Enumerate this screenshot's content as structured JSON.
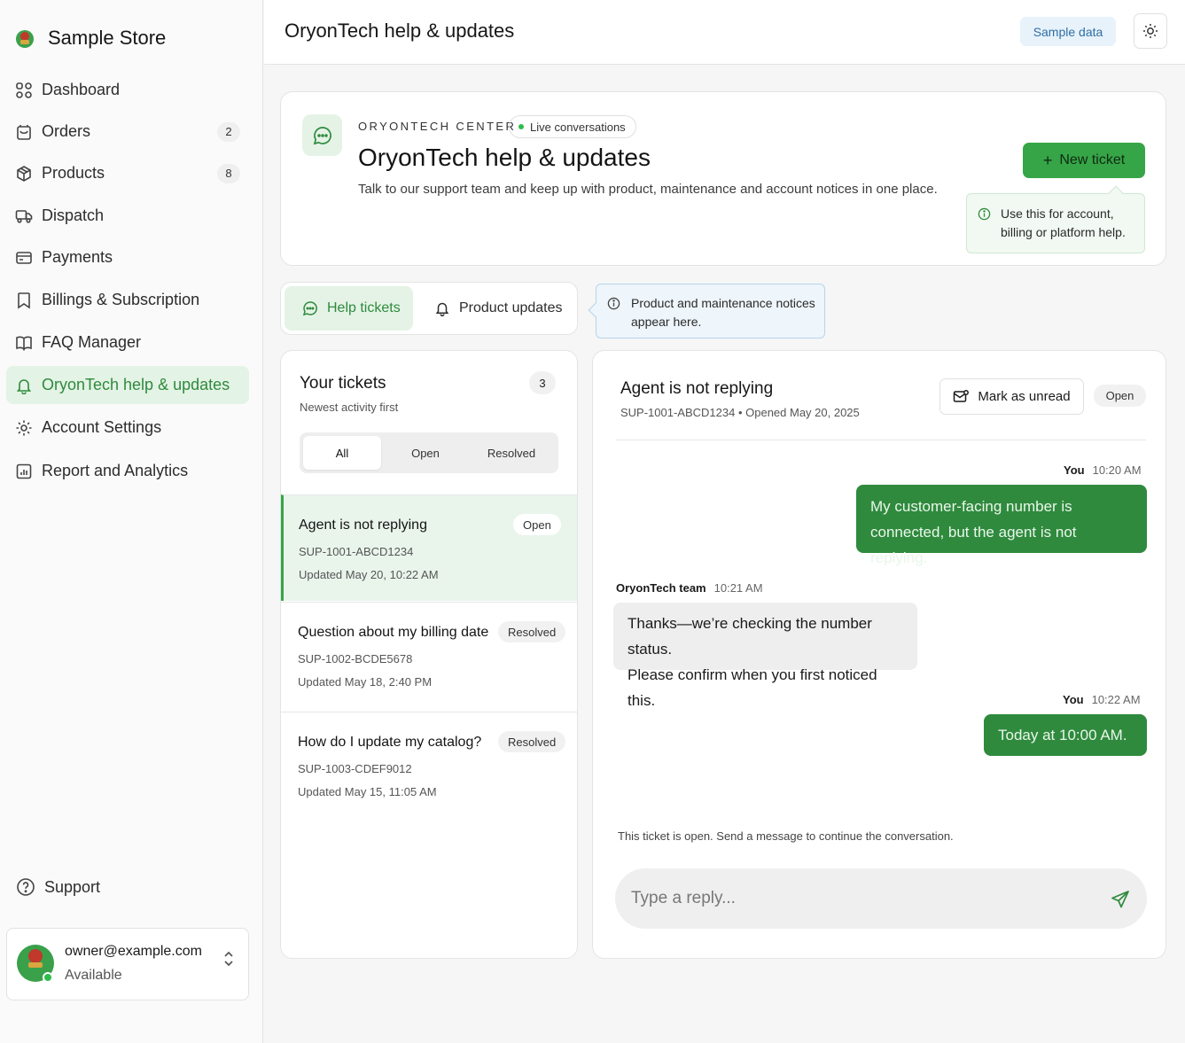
{
  "brand": {
    "name": "Sample Store"
  },
  "sidebar": {
    "items": [
      {
        "label": "Dashboard",
        "icon": "dashboard-icon"
      },
      {
        "label": "Orders",
        "icon": "orders-icon",
        "badge": "2"
      },
      {
        "label": "Products",
        "icon": "products-icon",
        "badge": "8"
      },
      {
        "label": "Dispatch",
        "icon": "truck-icon"
      },
      {
        "label": "Payments",
        "icon": "payments-icon"
      },
      {
        "label": "Billings & Subscription",
        "icon": "bookmark-icon"
      },
      {
        "label": "FAQ Manager",
        "icon": "book-icon"
      },
      {
        "label": "OryonTech help & updates",
        "icon": "bell-icon",
        "active": true
      },
      {
        "label": "Account Settings",
        "icon": "gear-icon"
      },
      {
        "label": "Report and Analytics",
        "icon": "report-icon"
      }
    ],
    "support_label": "Support",
    "user": {
      "email": "owner@example.com",
      "status": "Available"
    }
  },
  "header": {
    "title": "OryonTech help & updates",
    "sample_data_label": "Sample data"
  },
  "hero": {
    "eyebrow": "ORYONTECH CENTER",
    "live_label": "Live conversations",
    "title": "OryonTech help & updates",
    "description": "Talk to our support team and keep up with product, maintenance and account notices in one place.",
    "new_ticket_label": "New ticket",
    "hint_line1": "Use this for account,",
    "hint_line2": "billing or platform help."
  },
  "tabs": {
    "help_label": "Help tickets",
    "updates_label": "Product updates",
    "notice_line1": "Product and maintenance notices",
    "notice_line2": "appear here."
  },
  "tickets": {
    "title": "Your tickets",
    "subtitle": "Newest activity first",
    "count": "3",
    "filters": [
      "All",
      "Open",
      "Resolved"
    ],
    "items": [
      {
        "title": "Agent is not replying",
        "id": "SUP-1001-ABCD1234",
        "updated": "Updated May 20, 10:22 AM",
        "status": "Open"
      },
      {
        "title": "Question about my billing date",
        "id": "SUP-1002-BCDE5678",
        "updated": "Updated May 18, 2:40 PM",
        "status": "Resolved"
      },
      {
        "title": "How do I update my catalog?",
        "id": "SUP-1003-CDEF9012",
        "updated": "Updated May 15, 11:05 AM",
        "status": "Resolved"
      }
    ]
  },
  "conversation": {
    "title": "Agent is not replying",
    "meta": "SUP-1001-ABCD1234 • Opened May 20, 2025",
    "mark_unread_label": "Mark as unread",
    "status": "Open",
    "messages": [
      {
        "author": "You",
        "time": "10:20 AM",
        "line1": "My customer-facing number is",
        "line2": "connected, but the agent is not replying."
      },
      {
        "author": "OryonTech team",
        "time": "10:21 AM",
        "line1": "Thanks—we’re checking the number status.",
        "line2": "Please confirm when you first noticed this."
      },
      {
        "author": "You",
        "time": "10:22 AM",
        "line1": "Today at 10:00 AM."
      }
    ],
    "note": "This ticket is open. Send a message to continue the conversation.",
    "reply_placeholder": "Type a reply..."
  },
  "colors": {
    "accent": "#36a547",
    "accent_dark": "#2f8a3d",
    "accent_soft": "#e4f3e6",
    "info_soft": "#eef5fb"
  }
}
